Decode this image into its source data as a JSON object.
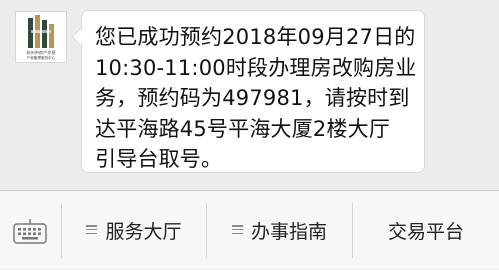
{
  "message": {
    "lines": [
      "您已成功预约2018年09月27日的",
      "10:30-11:00时段办理房改购房业",
      "务，预约码为497981，请按时到",
      "达平海路45号平海大厦2楼大厅",
      "引导台取号。"
    ]
  },
  "avatar": {
    "logo_icon": "building-logo-icon",
    "text_line1": "杭州市房产交易",
    "text_line2": "产权管理服务中心"
  },
  "menu": {
    "keyboard_icon": "keyboard-icon",
    "items": [
      {
        "label": "服务大厅",
        "icon": "menu-lines-icon"
      },
      {
        "label": "办事指南",
        "icon": "menu-lines-icon"
      },
      {
        "label": "交易平台"
      }
    ]
  },
  "colors": {
    "background": "#ececec",
    "bubble": "#ffffff",
    "menu_bar": "#f7f7f7",
    "logo_dark": "#2f4a3a",
    "logo_gold": "#b89550"
  }
}
